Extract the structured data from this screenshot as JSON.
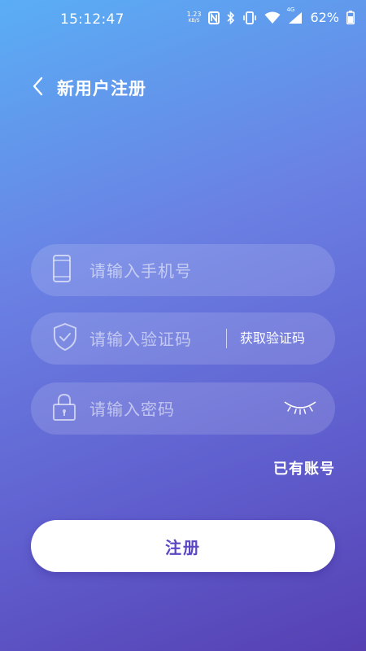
{
  "status_bar": {
    "time": "15:12:47",
    "net_speed_value": "1.23",
    "net_speed_unit": "KB/S",
    "network_type": "4G",
    "battery": "62%"
  },
  "header": {
    "title": "新用户注册"
  },
  "form": {
    "phone_placeholder": "请输入手机号",
    "code_placeholder": "请输入验证码",
    "get_code_label": "获取验证码",
    "password_placeholder": "请输入密码"
  },
  "have_account_label": "已有账号",
  "register_button_label": "注册",
  "icons": [
    "back-icon",
    "phone-icon",
    "shield-check-icon",
    "lock-icon",
    "eye-closed-icon"
  ],
  "colors": {
    "primary_text": "#5a47c4",
    "button_bg": "#ffffff"
  }
}
